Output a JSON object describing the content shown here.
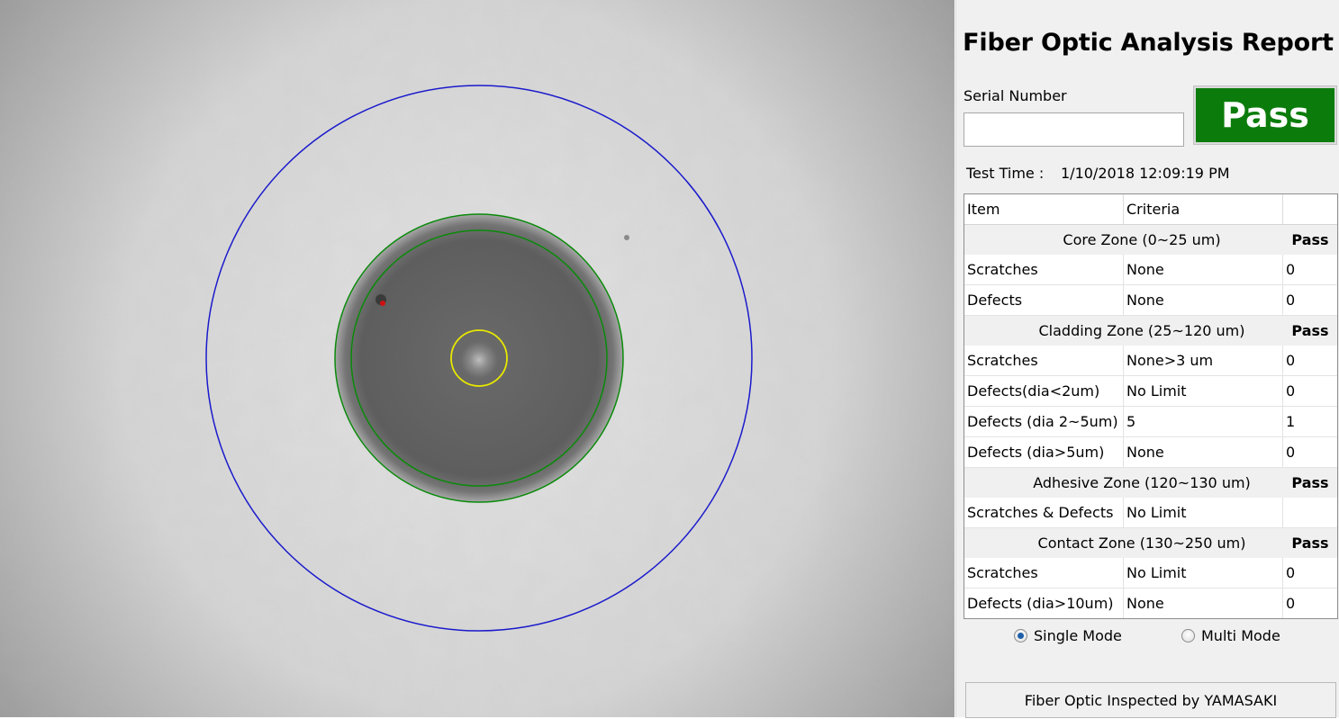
{
  "report": {
    "title": "Fiber Optic Analysis Report",
    "serial_label": "Serial Number",
    "serial_value": "",
    "status": "Pass",
    "status_color": "#0b7c0b",
    "test_time_label": "Test Time :",
    "test_time_value": "1/10/2018 12:09:19 PM"
  },
  "table": {
    "headers": [
      "Item",
      "Criteria",
      ""
    ],
    "zones": [
      {
        "name": "Core Zone (0~25 um)",
        "result": "Pass",
        "rows": [
          {
            "item": "Scratches",
            "criteria": "None",
            "count": "0"
          },
          {
            "item": "Defects",
            "criteria": "None",
            "count": "0"
          }
        ]
      },
      {
        "name": "Cladding Zone (25~120 um)",
        "result": "Pass",
        "rows": [
          {
            "item": "Scratches",
            "criteria": "None>3 um",
            "count": "0"
          },
          {
            "item": "Defects(dia<2um)",
            "criteria": "No Limit",
            "count": "0"
          },
          {
            "item": "Defects (dia 2~5um)",
            "criteria": "5",
            "count": "1"
          },
          {
            "item": "Defects (dia>5um)",
            "criteria": "None",
            "count": "0"
          }
        ]
      },
      {
        "name": "Adhesive Zone (120~130 um)",
        "result": "Pass",
        "rows": [
          {
            "item": "Scratches & Defects",
            "criteria": "No Limit",
            "count": ""
          }
        ]
      },
      {
        "name": "Contact Zone (130~250 um)",
        "result": "Pass",
        "rows": [
          {
            "item": "Scratches",
            "criteria": "No Limit",
            "count": "0"
          },
          {
            "item": "Defects (dia>10um)",
            "criteria": "None",
            "count": "0"
          }
        ]
      }
    ]
  },
  "modes": {
    "single_label": "Single Mode",
    "multi_label": "Multi Mode",
    "selected": "single"
  },
  "footer": {
    "text": "Fiber Optic Inspected by YAMASAKI"
  },
  "zone_colors": {
    "core": "#e8e800",
    "cladding": "#0a8a0a",
    "adhesive": "#0a8a0a",
    "contact": "#1a1acc",
    "defect_marker": "#d01010"
  }
}
